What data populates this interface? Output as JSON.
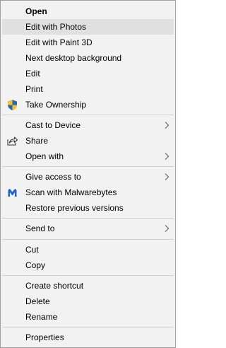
{
  "menu": {
    "items": [
      {
        "label": "Open"
      },
      {
        "label": "Edit with Photos"
      },
      {
        "label": "Edit with Paint 3D"
      },
      {
        "label": "Next desktop background"
      },
      {
        "label": "Edit"
      },
      {
        "label": "Print"
      },
      {
        "label": "Take Ownership",
        "icon": "uac-shield-icon"
      },
      {
        "label": "Cast to Device"
      },
      {
        "label": "Share",
        "icon": "share-icon"
      },
      {
        "label": "Open with"
      },
      {
        "label": "Give access to"
      },
      {
        "label": "Scan with Malwarebytes",
        "icon": "malwarebytes-icon"
      },
      {
        "label": "Restore previous versions"
      },
      {
        "label": "Send to"
      },
      {
        "label": "Cut"
      },
      {
        "label": "Copy"
      },
      {
        "label": "Create shortcut"
      },
      {
        "label": "Delete"
      },
      {
        "label": "Rename"
      },
      {
        "label": "Properties"
      }
    ]
  },
  "colors": {
    "menu_background": "#f2f2f2",
    "highlight": "#e0e0e0",
    "separator": "#cfcfcf",
    "border": "#a0a0a0",
    "shield_blue": "#2a64c8",
    "shield_yellow": "#f5c518",
    "malwarebytes_blue": "#1e64d6"
  }
}
